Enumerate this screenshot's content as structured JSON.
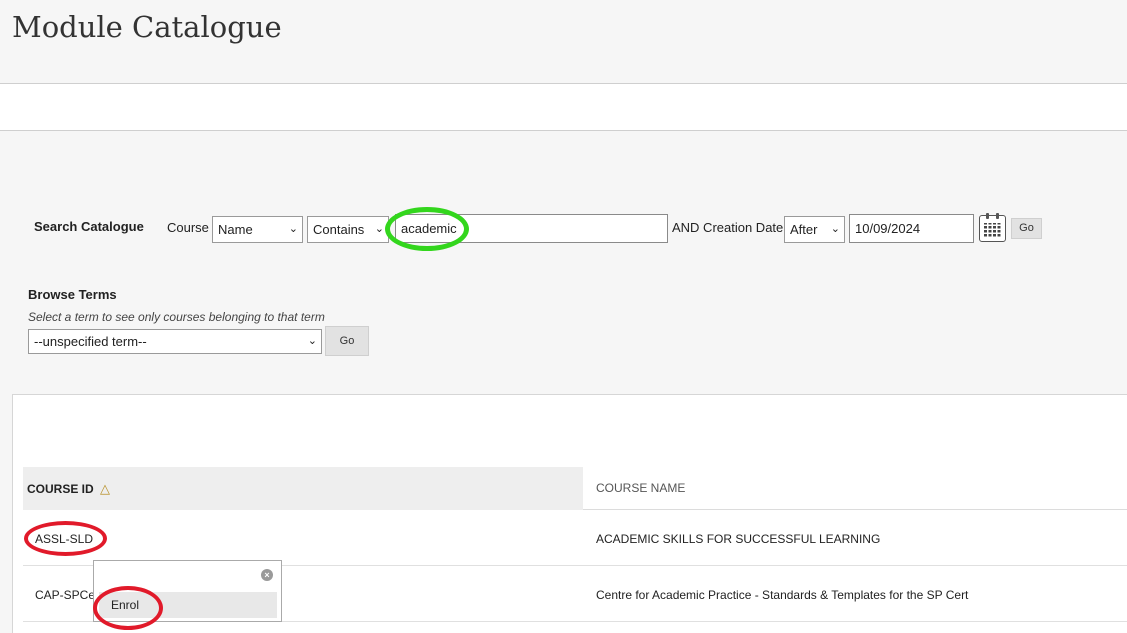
{
  "page": {
    "title": "Module Catalogue"
  },
  "search": {
    "label": "Search Catalogue",
    "course_label": "Course",
    "field_select": "Name",
    "operator_select": "Contains",
    "query_value": "academic",
    "and_label": "AND Creation Date",
    "date_operator": "After",
    "date_value": "10/09/2024",
    "go_label": "Go"
  },
  "browse": {
    "label": "Browse Terms",
    "hint": "Select a term to see only courses belonging to that term",
    "term_select": "--unspecified term--",
    "go_label": "Go"
  },
  "table": {
    "columns": [
      "COURSE ID",
      "COURSE NAME"
    ],
    "sort_indicator": "△",
    "rows": [
      {
        "id": "ASSL-SLD",
        "name": "ACADEMIC SKILLS FOR SUCCESSFUL LEARNING"
      },
      {
        "id": "CAP-SPCe",
        "name": "Centre for Academic Practice - Standards & Templates for the SP Cert"
      }
    ]
  },
  "context_menu": {
    "close_glyph": "×",
    "items": [
      "Enrol"
    ]
  },
  "icons": {
    "dropdown": "chevron-down-icon",
    "calendar": "calendar-icon",
    "sort": "sort-asc-icon",
    "close": "close-icon"
  },
  "colors": {
    "highlight_green": "#33d61d",
    "highlight_red": "#e11a2a"
  }
}
